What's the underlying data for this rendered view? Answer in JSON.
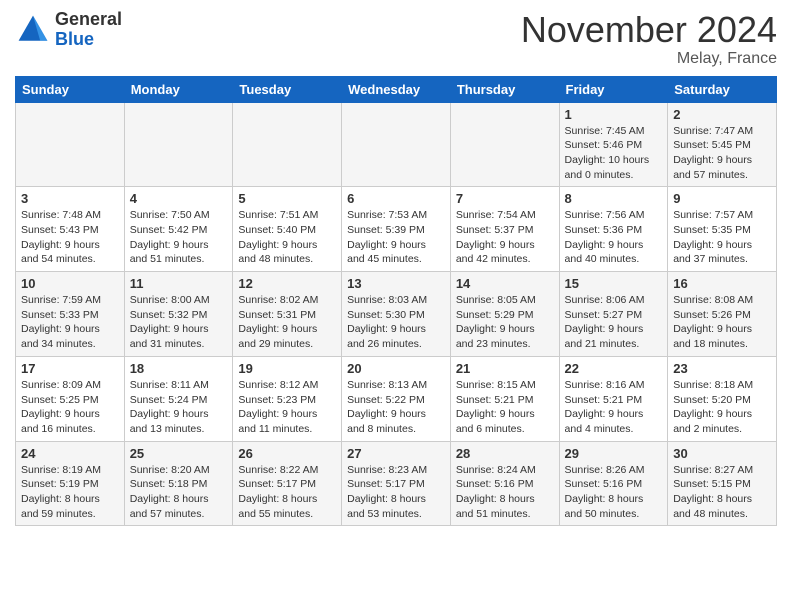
{
  "header": {
    "logo_general": "General",
    "logo_blue": "Blue",
    "month_title": "November 2024",
    "location": "Melay, France"
  },
  "weekdays": [
    "Sunday",
    "Monday",
    "Tuesday",
    "Wednesday",
    "Thursday",
    "Friday",
    "Saturday"
  ],
  "weeks": [
    [
      {
        "day": "",
        "info": ""
      },
      {
        "day": "",
        "info": ""
      },
      {
        "day": "",
        "info": ""
      },
      {
        "day": "",
        "info": ""
      },
      {
        "day": "",
        "info": ""
      },
      {
        "day": "1",
        "info": "Sunrise: 7:45 AM\nSunset: 5:46 PM\nDaylight: 10 hours\nand 0 minutes."
      },
      {
        "day": "2",
        "info": "Sunrise: 7:47 AM\nSunset: 5:45 PM\nDaylight: 9 hours\nand 57 minutes."
      }
    ],
    [
      {
        "day": "3",
        "info": "Sunrise: 7:48 AM\nSunset: 5:43 PM\nDaylight: 9 hours\nand 54 minutes."
      },
      {
        "day": "4",
        "info": "Sunrise: 7:50 AM\nSunset: 5:42 PM\nDaylight: 9 hours\nand 51 minutes."
      },
      {
        "day": "5",
        "info": "Sunrise: 7:51 AM\nSunset: 5:40 PM\nDaylight: 9 hours\nand 48 minutes."
      },
      {
        "day": "6",
        "info": "Sunrise: 7:53 AM\nSunset: 5:39 PM\nDaylight: 9 hours\nand 45 minutes."
      },
      {
        "day": "7",
        "info": "Sunrise: 7:54 AM\nSunset: 5:37 PM\nDaylight: 9 hours\nand 42 minutes."
      },
      {
        "day": "8",
        "info": "Sunrise: 7:56 AM\nSunset: 5:36 PM\nDaylight: 9 hours\nand 40 minutes."
      },
      {
        "day": "9",
        "info": "Sunrise: 7:57 AM\nSunset: 5:35 PM\nDaylight: 9 hours\nand 37 minutes."
      }
    ],
    [
      {
        "day": "10",
        "info": "Sunrise: 7:59 AM\nSunset: 5:33 PM\nDaylight: 9 hours\nand 34 minutes."
      },
      {
        "day": "11",
        "info": "Sunrise: 8:00 AM\nSunset: 5:32 PM\nDaylight: 9 hours\nand 31 minutes."
      },
      {
        "day": "12",
        "info": "Sunrise: 8:02 AM\nSunset: 5:31 PM\nDaylight: 9 hours\nand 29 minutes."
      },
      {
        "day": "13",
        "info": "Sunrise: 8:03 AM\nSunset: 5:30 PM\nDaylight: 9 hours\nand 26 minutes."
      },
      {
        "day": "14",
        "info": "Sunrise: 8:05 AM\nSunset: 5:29 PM\nDaylight: 9 hours\nand 23 minutes."
      },
      {
        "day": "15",
        "info": "Sunrise: 8:06 AM\nSunset: 5:27 PM\nDaylight: 9 hours\nand 21 minutes."
      },
      {
        "day": "16",
        "info": "Sunrise: 8:08 AM\nSunset: 5:26 PM\nDaylight: 9 hours\nand 18 minutes."
      }
    ],
    [
      {
        "day": "17",
        "info": "Sunrise: 8:09 AM\nSunset: 5:25 PM\nDaylight: 9 hours\nand 16 minutes."
      },
      {
        "day": "18",
        "info": "Sunrise: 8:11 AM\nSunset: 5:24 PM\nDaylight: 9 hours\nand 13 minutes."
      },
      {
        "day": "19",
        "info": "Sunrise: 8:12 AM\nSunset: 5:23 PM\nDaylight: 9 hours\nand 11 minutes."
      },
      {
        "day": "20",
        "info": "Sunrise: 8:13 AM\nSunset: 5:22 PM\nDaylight: 9 hours\nand 8 minutes."
      },
      {
        "day": "21",
        "info": "Sunrise: 8:15 AM\nSunset: 5:21 PM\nDaylight: 9 hours\nand 6 minutes."
      },
      {
        "day": "22",
        "info": "Sunrise: 8:16 AM\nSunset: 5:21 PM\nDaylight: 9 hours\nand 4 minutes."
      },
      {
        "day": "23",
        "info": "Sunrise: 8:18 AM\nSunset: 5:20 PM\nDaylight: 9 hours\nand 2 minutes."
      }
    ],
    [
      {
        "day": "24",
        "info": "Sunrise: 8:19 AM\nSunset: 5:19 PM\nDaylight: 8 hours\nand 59 minutes."
      },
      {
        "day": "25",
        "info": "Sunrise: 8:20 AM\nSunset: 5:18 PM\nDaylight: 8 hours\nand 57 minutes."
      },
      {
        "day": "26",
        "info": "Sunrise: 8:22 AM\nSunset: 5:17 PM\nDaylight: 8 hours\nand 55 minutes."
      },
      {
        "day": "27",
        "info": "Sunrise: 8:23 AM\nSunset: 5:17 PM\nDaylight: 8 hours\nand 53 minutes."
      },
      {
        "day": "28",
        "info": "Sunrise: 8:24 AM\nSunset: 5:16 PM\nDaylight: 8 hours\nand 51 minutes."
      },
      {
        "day": "29",
        "info": "Sunrise: 8:26 AM\nSunset: 5:16 PM\nDaylight: 8 hours\nand 50 minutes."
      },
      {
        "day": "30",
        "info": "Sunrise: 8:27 AM\nSunset: 5:15 PM\nDaylight: 8 hours\nand 48 minutes."
      }
    ]
  ]
}
